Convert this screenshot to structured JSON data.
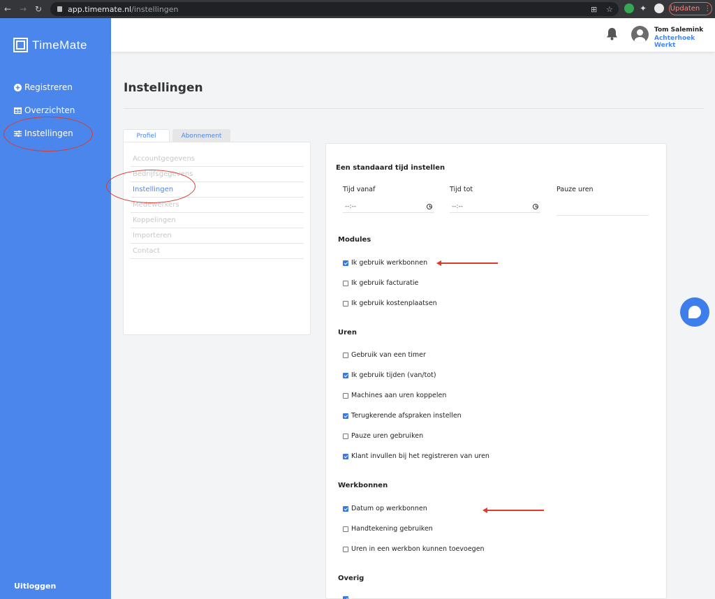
{
  "browser": {
    "url_host": "app.timemate.nl",
    "url_path": "/instellingen",
    "update_label": "Updaten"
  },
  "sidebar": {
    "logo": "TimeMate",
    "items": [
      {
        "label": "Registreren",
        "icon": "plus-circle-icon"
      },
      {
        "label": "Overzichten",
        "icon": "table-icon"
      },
      {
        "label": "Instellingen",
        "icon": "sliders-icon"
      }
    ],
    "logout": "Uitloggen"
  },
  "header": {
    "user_name": "Tom Salemink",
    "company": "Achterhoek Werkt"
  },
  "page": {
    "title": "Instellingen",
    "tabs": [
      {
        "label": "Profiel",
        "active": true
      },
      {
        "label": "Abonnement",
        "active": false
      }
    ],
    "menu": [
      {
        "label": "Accountgegevens"
      },
      {
        "label": "Bedrijfsgegevens"
      },
      {
        "label": "Instellingen",
        "active": true
      },
      {
        "label": "Medewerkers"
      },
      {
        "label": "Koppelingen"
      },
      {
        "label": "Importeren"
      },
      {
        "label": "Contact"
      }
    ]
  },
  "settings": {
    "time_section": {
      "title": "Een standaard tijd instellen",
      "from_label": "Tijd vanaf",
      "from_value": "--:--",
      "to_label": "Tijd tot",
      "to_value": "--:--",
      "pause_label": "Pauze uren",
      "pause_value": ""
    },
    "modules": {
      "title": "Modules",
      "options": [
        {
          "label": "Ik gebruik werkbonnen",
          "checked": true
        },
        {
          "label": "Ik gebruik facturatie",
          "checked": false
        },
        {
          "label": "Ik gebruik kostenplaatsen",
          "checked": false
        }
      ]
    },
    "uren": {
      "title": "Uren",
      "options": [
        {
          "label": "Gebruik van een timer",
          "checked": false
        },
        {
          "label": "Ik gebruik tijden (van/tot)",
          "checked": true
        },
        {
          "label": "Machines aan uren koppelen",
          "checked": false
        },
        {
          "label": "Terugkerende afspraken instellen",
          "checked": true
        },
        {
          "label": "Pauze uren gebruiken",
          "checked": false
        },
        {
          "label": "Klant invullen bij het registreren van uren",
          "checked": true
        }
      ]
    },
    "werkbonnen": {
      "title": "Werkbonnen",
      "options": [
        {
          "label": "Datum op werkbonnen",
          "checked": true
        },
        {
          "label": "Handtekening gebruiken",
          "checked": false
        },
        {
          "label": "Uren in een werkbon kunnen toevoegen",
          "checked": false
        }
      ]
    },
    "overig": {
      "title": "Overig"
    }
  },
  "colors": {
    "accent": "#4a86ec",
    "annotation": "#e03a2e"
  }
}
